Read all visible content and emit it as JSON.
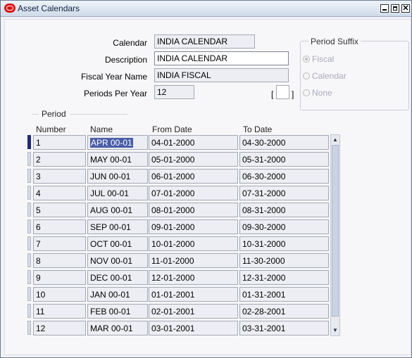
{
  "window": {
    "title": "Asset Calendars",
    "close_glyph": "✕"
  },
  "form": {
    "calendar_label": "Calendar",
    "calendar_value": "INDIA CALENDAR",
    "description_label": "Description",
    "description_value": "INDIA CALENDAR",
    "fiscal_year_label": "Fiscal Year Name",
    "fiscal_year_value": "INDIA FISCAL",
    "periods_label": "Periods Per Year",
    "periods_value": "12",
    "bracket_left": "[",
    "bracket_right": "]"
  },
  "period_suffix": {
    "title": "Period Suffix",
    "options": [
      {
        "label": "Fiscal",
        "selected": true
      },
      {
        "label": "Calendar",
        "selected": false
      },
      {
        "label": "None",
        "selected": false
      }
    ]
  },
  "period": {
    "title": "Period",
    "columns": {
      "number": "Number",
      "name": "Name",
      "from": "From Date",
      "to": "To Date"
    },
    "rows": [
      {
        "number": "1",
        "name": "APR 00-01",
        "from": "04-01-2000",
        "to": "04-30-2000"
      },
      {
        "number": "2",
        "name": "MAY 00-01",
        "from": "05-01-2000",
        "to": "05-31-2000"
      },
      {
        "number": "3",
        "name": "JUN 00-01",
        "from": "06-01-2000",
        "to": "06-30-2000"
      },
      {
        "number": "4",
        "name": "JUL 00-01",
        "from": "07-01-2000",
        "to": "07-31-2000"
      },
      {
        "number": "5",
        "name": "AUG 00-01",
        "from": "08-01-2000",
        "to": "08-31-2000"
      },
      {
        "number": "6",
        "name": "SEP 00-01",
        "from": "09-01-2000",
        "to": "09-30-2000"
      },
      {
        "number": "7",
        "name": "OCT 00-01",
        "from": "10-01-2000",
        "to": "10-31-2000"
      },
      {
        "number": "8",
        "name": "NOV 00-01",
        "from": "11-01-2000",
        "to": "11-30-2000"
      },
      {
        "number": "9",
        "name": "DEC 00-01",
        "from": "12-01-2000",
        "to": "12-31-2000"
      },
      {
        "number": "10",
        "name": "JAN 00-01",
        "from": "01-01-2001",
        "to": "01-31-2001"
      },
      {
        "number": "11",
        "name": "FEB 00-01",
        "from": "02-01-2001",
        "to": "02-28-2001"
      },
      {
        "number": "12",
        "name": "MAR 00-01",
        "from": "03-01-2001",
        "to": "03-31-2001"
      }
    ]
  },
  "scrollbar": {
    "up_glyph": "▲",
    "down_glyph": "▼"
  }
}
